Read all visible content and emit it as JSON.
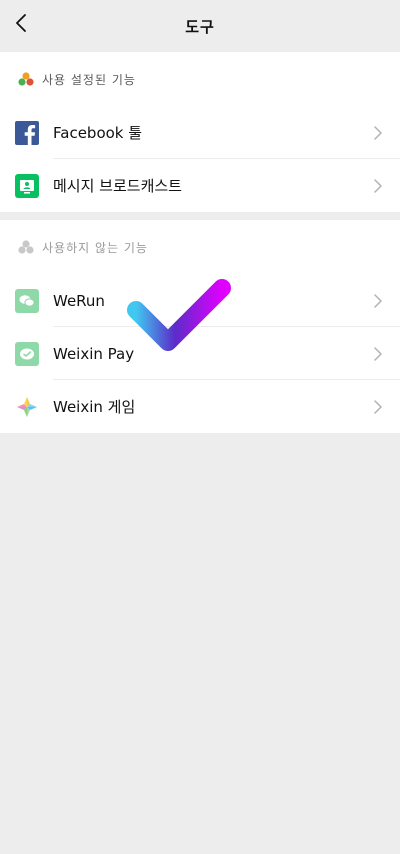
{
  "header": {
    "title": "도구"
  },
  "sections": {
    "enabled": {
      "label": "사용 설정된 기능",
      "items": [
        {
          "label": "Facebook 툴",
          "icon": "facebook-icon"
        },
        {
          "label": "메시지 브로드캐스트",
          "icon": "message-broadcast-icon"
        }
      ]
    },
    "disabled": {
      "label": "사용하지 않는 기능",
      "items": [
        {
          "label": "WeRun",
          "icon": "werun-icon"
        },
        {
          "label": "Weixin Pay",
          "icon": "weixin-pay-icon"
        },
        {
          "label": "Weixin 게임",
          "icon": "weixin-game-icon"
        }
      ]
    }
  },
  "colors": {
    "background": "#ededed",
    "facebook": "#3b5998",
    "broadcast": "#07c160",
    "disabled_green": "#8fd9a8",
    "check_start": "#41c8f0",
    "check_mid": "#5b2cc9",
    "check_end": "#e000ff"
  }
}
